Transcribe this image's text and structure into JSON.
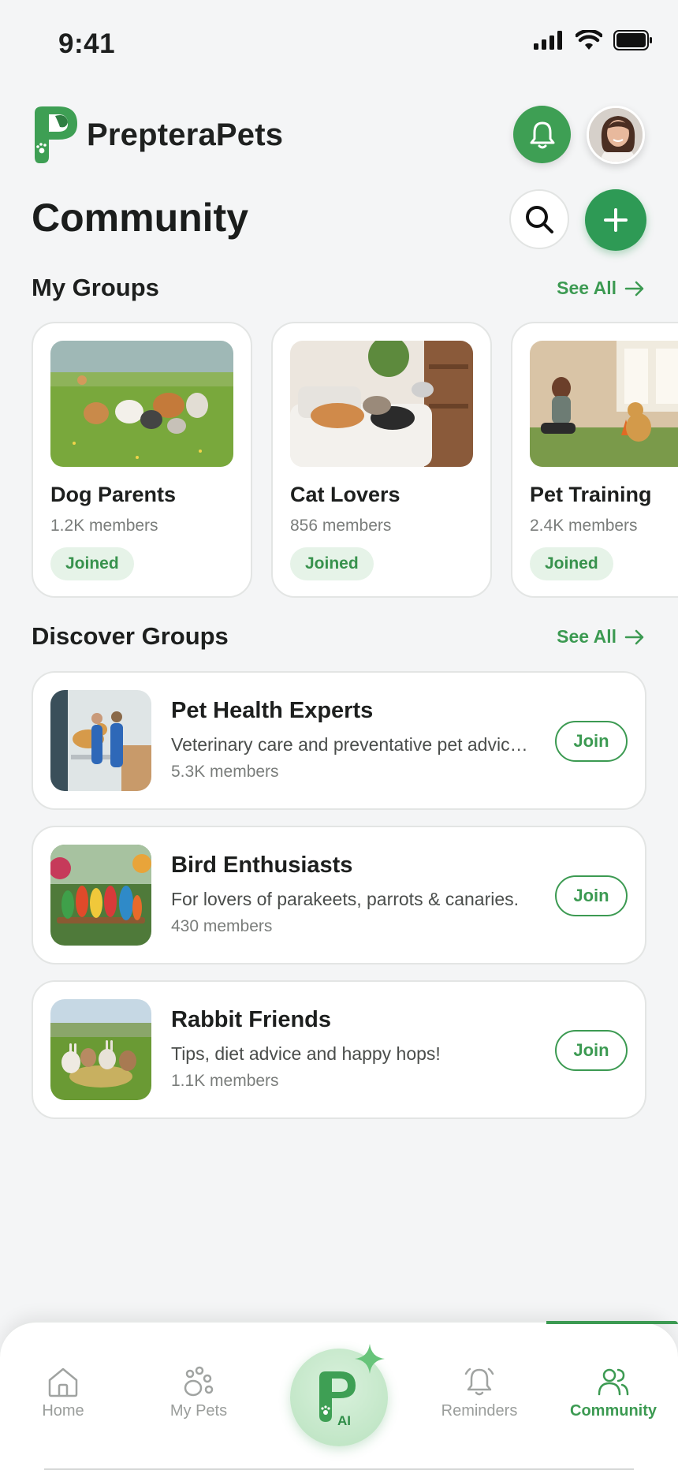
{
  "status_bar": {
    "time": "9:41"
  },
  "header": {
    "app_name": "PrepteraPets"
  },
  "page": {
    "title": "Community"
  },
  "my_groups": {
    "title": "My Groups",
    "see_all": "See All",
    "items": [
      {
        "name": "Dog Parents",
        "members": "1.2K members",
        "status": "Joined"
      },
      {
        "name": "Cat Lovers",
        "members": "856 members",
        "status": "Joined"
      },
      {
        "name": "Pet Training",
        "members": "2.4K members",
        "status": "Joined"
      }
    ]
  },
  "discover_groups": {
    "title": "Discover Groups",
    "see_all": "See All",
    "items": [
      {
        "name": "Pet Health Experts",
        "description": "Veterinary care and preventative pet advice for every owner.",
        "members": "5.3K members",
        "action": "Join"
      },
      {
        "name": "Bird Enthusiasts",
        "description": "For lovers of parakeets, parrots & canaries.",
        "members": "430 members",
        "action": "Join"
      },
      {
        "name": "Rabbit Friends",
        "description": "Tips, diet advice and happy hops!",
        "members": "1.1K members",
        "action": "Join"
      }
    ]
  },
  "bottom_nav": {
    "items": [
      {
        "label": "Home",
        "icon": "home-icon"
      },
      {
        "label": "My Pets",
        "icon": "paw-icon"
      },
      {
        "label": "AI",
        "icon": "ai-assistant-icon"
      },
      {
        "label": "Reminders",
        "icon": "bell-icon"
      },
      {
        "label": "Community",
        "icon": "community-icon"
      }
    ],
    "active": "Community"
  },
  "colors": {
    "brand_green": "#3c9a52",
    "accent_green": "#2e9a55",
    "badge_bg": "#e6f3e8",
    "background": "#f4f5f6"
  }
}
